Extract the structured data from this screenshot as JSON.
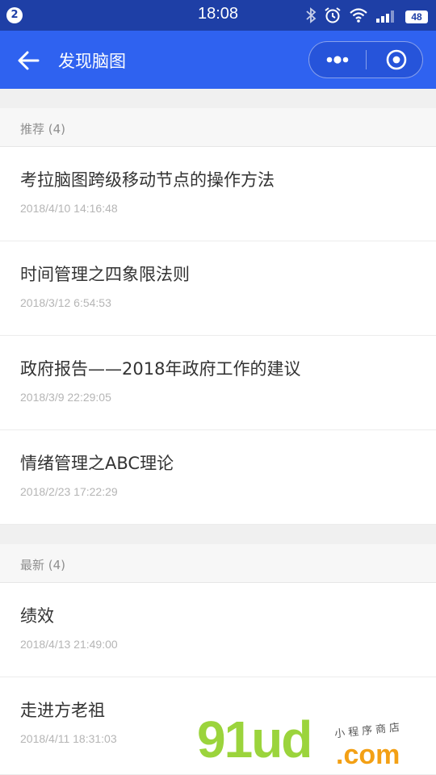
{
  "status_bar": {
    "notification_count": "2",
    "time": "18:08",
    "battery": "48",
    "icons": [
      "bluetooth-icon",
      "alarm-icon",
      "wifi-icon",
      "signal-icon",
      "battery-icon"
    ]
  },
  "nav": {
    "title": "发现脑图",
    "back_icon": "arrow-left-icon",
    "more_icon": "more-dots-icon",
    "close_icon": "target-circle-icon"
  },
  "sections": [
    {
      "header": "推荐 (4)",
      "items": [
        {
          "title": "考拉脑图跨级移动节点的操作方法",
          "date": "2018/4/10 14:16:48"
        },
        {
          "title": "时间管理之四象限法则",
          "date": "2018/3/12 6:54:53"
        },
        {
          "title": "政府报告——2018年政府工作的建议",
          "date": "2018/3/9 22:29:05"
        },
        {
          "title": "情绪管理之ABC理论",
          "date": "2018/2/23 17:22:29"
        }
      ]
    },
    {
      "header": "最新 (4)",
      "items": [
        {
          "title": "绩效",
          "date": "2018/4/13 21:49:00"
        },
        {
          "title": "走进方老祖",
          "date": "2018/4/11 18:31:03"
        }
      ]
    }
  ],
  "watermark": {
    "main": "91ud",
    "suffix": ".com",
    "tagline": "小程序商店"
  },
  "colors": {
    "status_bar": "#1e3fa6",
    "nav_bar": "#2f62f0",
    "watermark_green": "#9bd43c",
    "watermark_orange": "#f3a015"
  }
}
